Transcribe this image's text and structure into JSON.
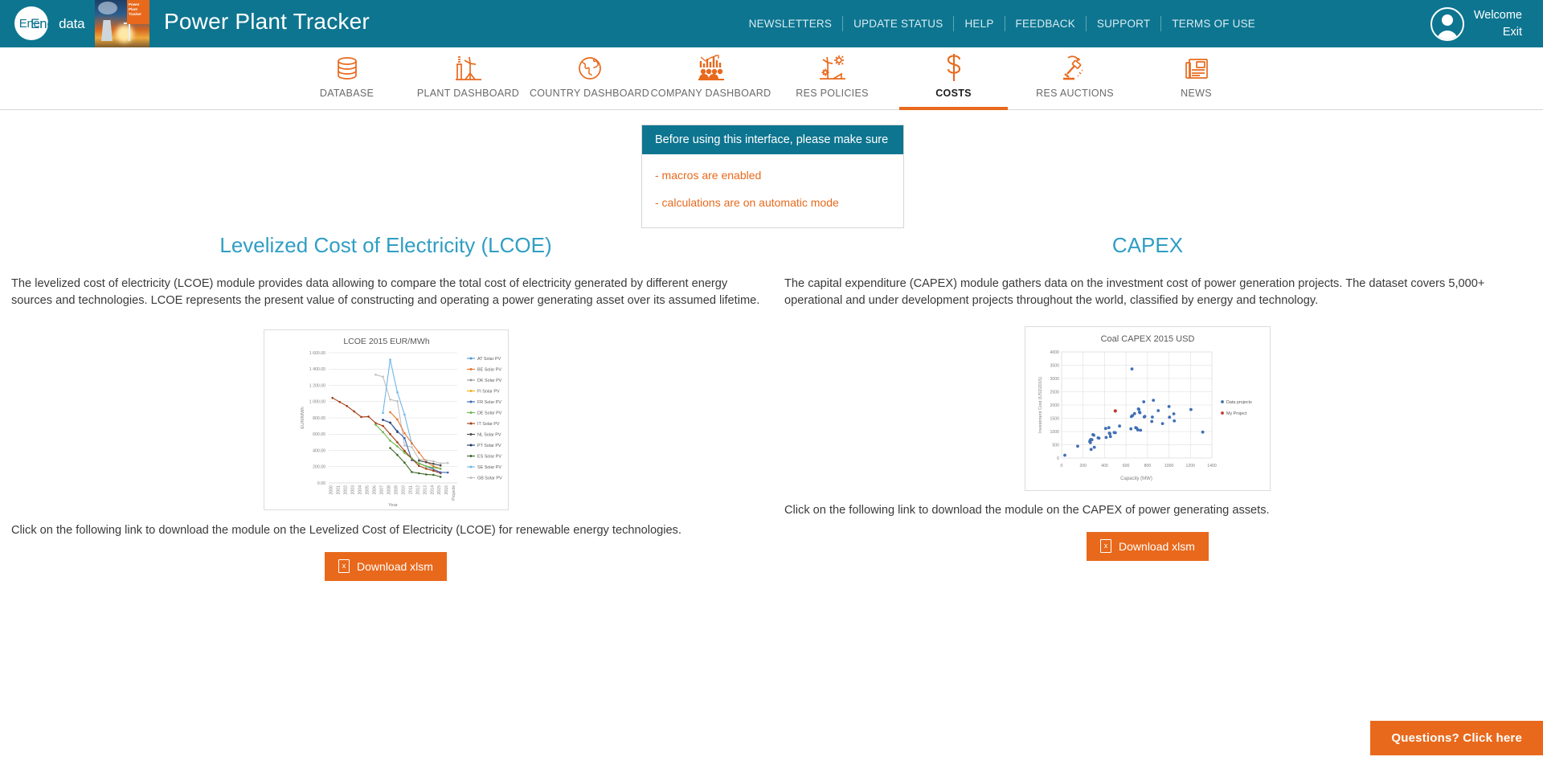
{
  "brand": {
    "logo_circle_text": "Ener",
    "logo_word": "data",
    "thumb_badge": "Power Plant Tracker",
    "app_title": "Power Plant Tracker",
    "accent_orange": "#e8691c",
    "teal": "#0d7590",
    "heading_blue": "#2f9ec4"
  },
  "header": {
    "links": [
      "NEWSLETTERS",
      "UPDATE STATUS",
      "HELP",
      "FEEDBACK",
      "SUPPORT",
      "TERMS OF USE"
    ],
    "welcome": "Welcome",
    "exit": "Exit"
  },
  "nav": {
    "items": [
      {
        "label": "DATABASE",
        "icon": "database-icon",
        "active": false
      },
      {
        "label": "PLANT DASHBOARD",
        "icon": "plant-icon",
        "active": false
      },
      {
        "label": "COUNTRY DASHBOARD",
        "icon": "globe-icon",
        "active": false
      },
      {
        "label": "COMPANY DASHBOARD",
        "icon": "company-chart-icon",
        "active": false
      },
      {
        "label": "RES POLICIES",
        "icon": "renewables-icon",
        "active": false
      },
      {
        "label": "COSTS",
        "icon": "dollar-icon",
        "active": true
      },
      {
        "label": "RES AUCTIONS",
        "icon": "auction-gavel-icon",
        "active": false
      },
      {
        "label": "NEWS",
        "icon": "newspaper-icon",
        "active": false
      }
    ]
  },
  "notice": {
    "title": "Before using this interface, please make sure",
    "lines": [
      "- macros are enabled",
      "- calculations are on automatic mode"
    ]
  },
  "lcoe": {
    "title": "Levelized Cost of Electricity (LCOE)",
    "description": "The levelized cost of electricity (LCOE) module provides data allowing to compare the total cost of electricity generated by different energy sources and technologies. LCOE represents the present value of constructing and operating a power generating asset over its assumed lifetime.",
    "caption": "Click on the following link to download the module on the Levelized Cost of Electricity (LCOE) for renewable energy technologies.",
    "download_label": "Download xlsm"
  },
  "capex": {
    "title": "CAPEX",
    "description": "The capital expenditure (CAPEX) module gathers data on the investment cost of power generation projects. The dataset covers 5,000+ operational and under development projects throughout the world, classified by energy and technology.",
    "caption": "Click on the following link to download the module on the CAPEX of power generating assets.",
    "download_label": "Download xlsm"
  },
  "questions_button": {
    "label": "Questions? Click here"
  },
  "chart_data": [
    {
      "type": "line",
      "id": "lcoe-chart",
      "title": "LCOE 2015 EUR/MWh",
      "xlabel": "Year",
      "ylabel": "EUR/MWh",
      "ylim": [
        0,
        1600
      ],
      "yticks": [
        "0.00",
        "200.00",
        "400.00",
        "600.00",
        "800.00",
        "1 000.00",
        "1 200.00",
        "1 400.00",
        "1 600.00"
      ],
      "grid": true,
      "legend_position": "right",
      "categories": [
        "2000",
        "2001",
        "2002",
        "2003",
        "2004",
        "2005",
        "2006",
        "2007",
        "2008",
        "2009",
        "2010",
        "2011",
        "2012",
        "2013",
        "2014",
        "2015",
        "2016",
        "Projects"
      ],
      "series": [
        {
          "name": "AT Solar PV",
          "color": "#4f96d2",
          "values": [
            null,
            null,
            null,
            null,
            null,
            null,
            null,
            null,
            null,
            null,
            null,
            null,
            null,
            null,
            null,
            null,
            null,
            null
          ]
        },
        {
          "name": "BE Solar PV",
          "color": "#e8762c",
          "values": [
            null,
            null,
            null,
            null,
            null,
            null,
            null,
            null,
            870,
            780,
            610,
            490,
            375,
            260,
            205,
            175,
            null,
            null
          ]
        },
        {
          "name": "DK Solar PV",
          "color": "#9b9b9b",
          "values": [
            null,
            null,
            null,
            null,
            null,
            null,
            null,
            null,
            null,
            null,
            null,
            null,
            null,
            null,
            null,
            null,
            null,
            null
          ]
        },
        {
          "name": "FI Solar PV",
          "color": "#f2b418",
          "values": [
            null,
            null,
            null,
            null,
            null,
            null,
            null,
            null,
            null,
            null,
            null,
            null,
            null,
            null,
            null,
            null,
            null,
            null
          ]
        },
        {
          "name": "FR Solar PV",
          "color": "#3c62b0",
          "values": [
            null,
            null,
            null,
            null,
            null,
            null,
            null,
            775,
            740,
            635,
            550,
            280,
            null,
            null,
            null,
            130,
            128,
            null
          ]
        },
        {
          "name": "DE Solar PV",
          "color": "#6fb44a",
          "values": [
            null,
            null,
            null,
            null,
            null,
            null,
            715,
            625,
            520,
            450,
            370,
            300,
            240,
            205,
            190,
            175,
            null,
            null
          ]
        },
        {
          "name": "IT Solar PV",
          "color": "#a23d12",
          "values": [
            1045,
            995,
            945,
            880,
            810,
            815,
            735,
            700,
            600,
            500,
            395,
            300,
            210,
            175,
            150,
            120,
            null,
            null
          ]
        },
        {
          "name": "NL Solar PV",
          "color": "#4a4a4a",
          "values": [
            null,
            null,
            null,
            null,
            null,
            null,
            null,
            null,
            null,
            null,
            null,
            null,
            275,
            255,
            235,
            215,
            null,
            null
          ]
        },
        {
          "name": "PT Solar PV",
          "color": "#1f3864",
          "values": [
            null,
            null,
            null,
            null,
            null,
            null,
            null,
            780,
            745,
            630,
            null,
            null,
            null,
            null,
            null,
            null,
            null,
            null
          ]
        },
        {
          "name": "ES Solar PV",
          "color": "#3d6b28",
          "values": [
            null,
            null,
            null,
            null,
            null,
            null,
            null,
            null,
            430,
            345,
            250,
            135,
            120,
            105,
            100,
            75,
            null,
            null
          ]
        },
        {
          "name": "SE Solar PV",
          "color": "#6cb6e8",
          "values": [
            null,
            null,
            null,
            null,
            null,
            null,
            null,
            860,
            1515,
            1115,
            840,
            480,
            null,
            null,
            null,
            null,
            null,
            null
          ]
        },
        {
          "name": "GB Solar PV",
          "color": "#bfbfbf",
          "values": [
            null,
            null,
            null,
            null,
            null,
            null,
            1330,
            1305,
            1025,
            1010,
            460,
            440,
            290,
            280,
            265,
            240,
            245,
            null
          ]
        }
      ]
    },
    {
      "type": "scatter",
      "id": "capex-chart",
      "title": "Coal CAPEX 2015 USD",
      "xlabel": "Capacity (MW)",
      "ylabel": "Investment Cost (USD2015)",
      "xlim": [
        0,
        1400
      ],
      "ylim": [
        0,
        4000
      ],
      "xticks": [
        "0",
        "200",
        "400",
        "600",
        "800",
        "1000",
        "1200",
        "1400"
      ],
      "yticks": [
        "0",
        "500",
        "1000",
        "1500",
        "2000",
        "2500",
        "3000",
        "3500",
        "4000"
      ],
      "grid": true,
      "legend_position": "right",
      "series": [
        {
          "name": "Data projects",
          "color": "#3f6fb5",
          "points": [
            [
              30,
              105
            ],
            [
              150,
              445
            ],
            [
              262,
              620
            ],
            [
              265,
              660
            ],
            [
              268,
              580
            ],
            [
              272,
              700
            ],
            [
              275,
              325
            ],
            [
              282,
              690
            ],
            [
              292,
              880
            ],
            [
              300,
              860
            ],
            [
              305,
              405
            ],
            [
              340,
              760
            ],
            [
              348,
              750
            ],
            [
              410,
              1115
            ],
            [
              415,
              775
            ],
            [
              440,
              1145
            ],
            [
              445,
              940
            ],
            [
              450,
              915
            ],
            [
              455,
              810
            ],
            [
              490,
              960
            ],
            [
              500,
              955
            ],
            [
              540,
              1205
            ],
            [
              645,
              1100
            ],
            [
              650,
              1565
            ],
            [
              655,
              3360
            ],
            [
              660,
              1600
            ],
            [
              680,
              1675
            ],
            [
              690,
              1145
            ],
            [
              700,
              1125
            ],
            [
              710,
              1060
            ],
            [
              715,
              1850
            ],
            [
              720,
              1835
            ],
            [
              725,
              1730
            ],
            [
              730,
              1710
            ],
            [
              735,
              1050
            ],
            [
              765,
              2120
            ],
            [
              770,
              1550
            ],
            [
              775,
              1570
            ],
            [
              840,
              1380
            ],
            [
              845,
              1545
            ],
            [
              855,
              2180
            ],
            [
              900,
              1790
            ],
            [
              940,
              1300
            ],
            [
              1000,
              1940
            ],
            [
              1005,
              1540
            ],
            [
              1045,
              1665
            ],
            [
              1050,
              1400
            ],
            [
              1205,
              1830
            ],
            [
              1315,
              980
            ]
          ]
        },
        {
          "name": "My Project",
          "color": "#c0392b",
          "points": [
            [
              500,
              1775
            ]
          ]
        }
      ]
    }
  ]
}
